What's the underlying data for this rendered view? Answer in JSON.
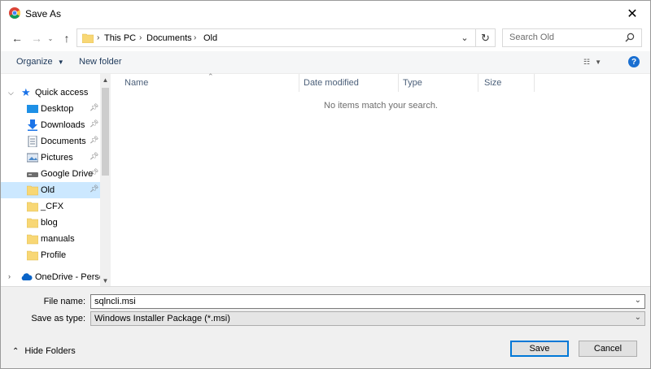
{
  "window": {
    "title": "Save As"
  },
  "address": {
    "crumbs": [
      "This PC",
      "Documents",
      "Old"
    ],
    "search_placeholder": "Search Old"
  },
  "toolbar": {
    "organize": "Organize",
    "new_folder": "New folder"
  },
  "nav": {
    "quick_access": "Quick access",
    "items": [
      {
        "label": "Desktop",
        "icon": "desktop-icon",
        "pinned": true
      },
      {
        "label": "Downloads",
        "icon": "downloads-icon",
        "pinned": true
      },
      {
        "label": "Documents",
        "icon": "documents-icon",
        "pinned": true
      },
      {
        "label": "Pictures",
        "icon": "pictures-icon",
        "pinned": true
      },
      {
        "label": "Google Drive",
        "icon": "drive-icon",
        "pinned": true
      },
      {
        "label": "Old",
        "icon": "folder-icon",
        "pinned": true,
        "selected": true
      },
      {
        "label": "_CFX",
        "icon": "folder-icon"
      },
      {
        "label": "blog",
        "icon": "folder-icon"
      },
      {
        "label": "manuals",
        "icon": "folder-icon"
      },
      {
        "label": "Profile",
        "icon": "folder-icon"
      }
    ],
    "onedrive": "OneDrive - Persor"
  },
  "columns": [
    "Name",
    "Date modified",
    "Type",
    "Size"
  ],
  "empty_message": "No items match your search.",
  "form": {
    "file_name_label": "File name:",
    "file_name_value": "sqlncli.msi",
    "save_type_label": "Save as type:",
    "save_type_value": "Windows Installer Package (*.msi)"
  },
  "footer": {
    "hide_folders": "Hide Folders",
    "save": "Save",
    "cancel": "Cancel"
  },
  "colors": {
    "accent": "#0078d7",
    "selected": "#cce8ff",
    "folder": "#f8d775"
  }
}
